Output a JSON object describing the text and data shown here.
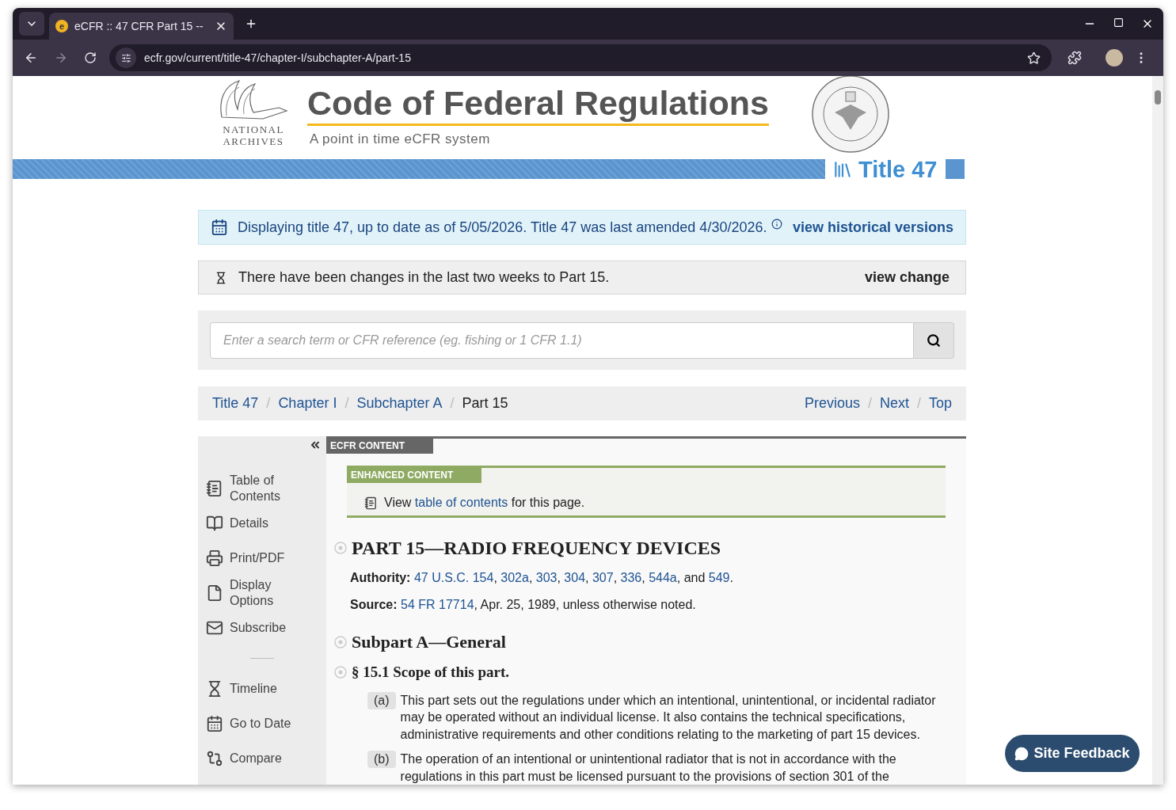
{
  "browser": {
    "tab": {
      "favicon": "e",
      "title": "eCFR :: 47 CFR Part 15 --"
    },
    "url": "ecfr.gov/current/title-47/chapter-I/subchapter-A/part-15"
  },
  "header": {
    "logo_text": [
      "NATIONAL",
      "ARCHIVES"
    ],
    "title": "Code of Federal Regulations",
    "subtitle": "A point in time eCFR system",
    "title_badge": "Title 47"
  },
  "alerts": [
    {
      "kind": "info",
      "text": "Displaying title 47, up to date as of 5/05/2026. Title 47 was last amended 4/30/2026.",
      "action": "view historical versions"
    },
    {
      "kind": "changes",
      "text": "There have been changes in the last two weeks to Part 15.",
      "action": "view change"
    }
  ],
  "search": {
    "placeholder": "Enter a search term or CFR reference (eg. fishing or 1 CFR 1.1)"
  },
  "breadcrumbs": [
    {
      "label": "Title 47",
      "current": false
    },
    {
      "label": "Chapter I",
      "current": false
    },
    {
      "label": "Subchapter A",
      "current": false
    },
    {
      "label": "Part 15",
      "current": true
    }
  ],
  "nav_links": [
    "Previous",
    "Next",
    "Top"
  ],
  "separator": "/",
  "sidebar": {
    "items": [
      {
        "kind": "toc",
        "label": "Table of Contents"
      },
      {
        "kind": "details",
        "label": "Details"
      },
      {
        "kind": "print",
        "label": "Print/PDF"
      },
      {
        "kind": "display",
        "label": "Display Options"
      },
      {
        "kind": "subscribe",
        "label": "Subscribe"
      },
      {
        "kind": "divider"
      },
      {
        "kind": "timeline",
        "label": "Timeline"
      },
      {
        "kind": "date",
        "label": "Go to Date"
      },
      {
        "kind": "compare",
        "label": "Compare"
      }
    ]
  },
  "content": {
    "tab": "ECFR CONTENT",
    "enhanced": {
      "label": "ENHANCED CONTENT",
      "before": "View ",
      "link": "table of contents",
      "after": " for this page."
    },
    "part_heading": "PART 15—RADIO FREQUENCY DEVICES",
    "authority": {
      "label": "Authority:",
      "parts": [
        {
          "kind": "link",
          "text": "47 U.S.C. 154"
        },
        {
          "kind": "text",
          "text": ", "
        },
        {
          "kind": "link",
          "text": "302a"
        },
        {
          "kind": "text",
          "text": ", "
        },
        {
          "kind": "link",
          "text": "303"
        },
        {
          "kind": "text",
          "text": ", "
        },
        {
          "kind": "link",
          "text": "304"
        },
        {
          "kind": "text",
          "text": ", "
        },
        {
          "kind": "link",
          "text": "307"
        },
        {
          "kind": "text",
          "text": ", "
        },
        {
          "kind": "link",
          "text": "336"
        },
        {
          "kind": "text",
          "text": ", "
        },
        {
          "kind": "link",
          "text": "544a"
        },
        {
          "kind": "text",
          "text": ", and "
        },
        {
          "kind": "link",
          "text": "549"
        },
        {
          "kind": "text",
          "text": "."
        }
      ]
    },
    "source": {
      "label": "Source:",
      "link": "54 FR 17714",
      "rest": ", Apr. 25, 1989, unless otherwise noted."
    },
    "subpart_heading": "Subpart A—General",
    "section_heading": "§ 15.1 Scope of this part.",
    "paragraphs": [
      {
        "marker": "(a)",
        "text": "This part sets out the regulations under which an intentional, unintentional, or incidental radiator may be operated without an individual license. It also contains the technical specifications, administrative requirements and other conditions relating to the marketing of part 15 devices."
      },
      {
        "marker": "(b)",
        "text": "The operation of an intentional or unintentional radiator that is not in accordance with the regulations in this part must be licensed pursuant to the provisions of section 301 of the"
      }
    ]
  },
  "feedback_button": "Site Feedback"
}
